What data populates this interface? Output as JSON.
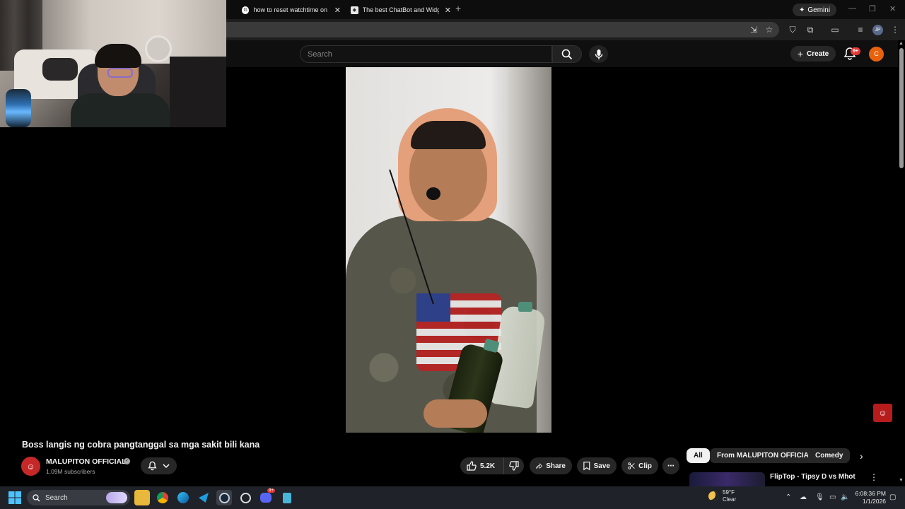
{
  "browser": {
    "tabs": [
      {
        "title": "how to reset watchtime on bot"
      },
      {
        "title": "The best ChatBot and Widgets"
      }
    ],
    "new_tab_label": "+",
    "gemini_label": "Gemini",
    "profile_initials": "JP"
  },
  "youtube": {
    "search_placeholder": "Search",
    "create_label": "Create",
    "notifications_badge": "9+",
    "account_initial": "C"
  },
  "video": {
    "title": "Boss langis ng cobra pangtanggal sa mga sakit bili kana",
    "channel_name": "MALUPITON OFFICIAL",
    "subscribers": "1.09M subscribers",
    "likes": "5.2K",
    "share_label": "Share",
    "save_label": "Save",
    "clip_label": "Clip"
  },
  "sidebar": {
    "chips": [
      "All",
      "From MALUPITON OFFICIAL",
      "Comedy"
    ],
    "recommendations": [
      {
        "title": "FlipTop - Tipsy D vs Mhot"
      }
    ]
  },
  "taskbar": {
    "search_label": "Search",
    "weather_temp": "59°F",
    "weather_cond": "Clear",
    "time": "6:08:36 PM",
    "date": "1/1/2026",
    "discord_badge": "9+"
  },
  "colors": {
    "yt_background": "#0f0f0f",
    "accent_red": "#e53935",
    "account_orange": "#e8620d",
    "taskbar": "#1f2228"
  },
  "icons": [
    "search-icon",
    "mic-icon",
    "bell-icon",
    "thumbs-up-icon",
    "thumbs-down-icon",
    "share-icon",
    "bookmark-icon",
    "scissors-icon",
    "more-icon",
    "chevron-right-icon",
    "windows-start-icon"
  ]
}
